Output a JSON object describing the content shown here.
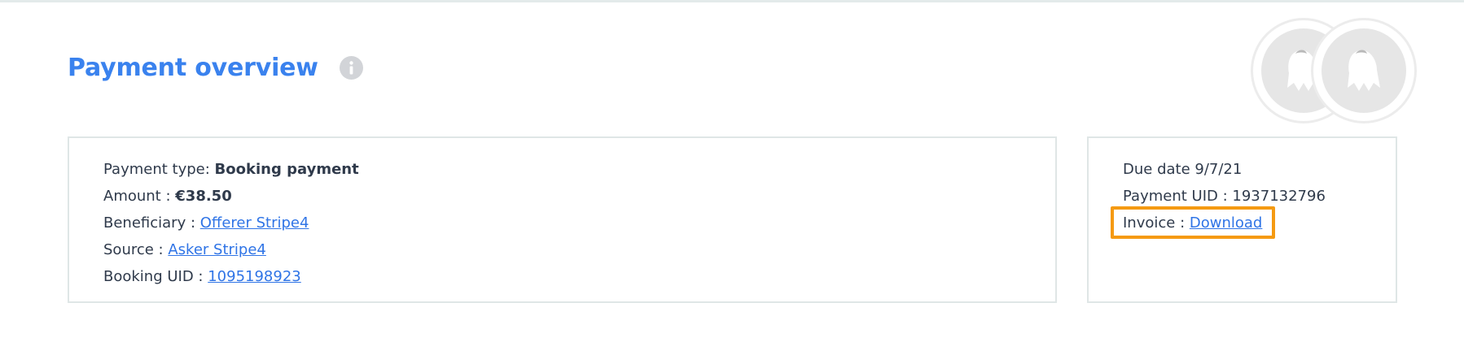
{
  "header": {
    "title": "Payment overview"
  },
  "payment": {
    "type_label": "Payment type:",
    "type_value": "Booking payment",
    "amount_label": "Amount :",
    "amount_value": "€38.50",
    "beneficiary_label": "Beneficiary :",
    "beneficiary_value": "Offerer Stripe4",
    "source_label": "Source :",
    "source_value": "Asker Stripe4",
    "booking_uid_label": "Booking UID :",
    "booking_uid_value": "1095198923"
  },
  "side": {
    "due_date_label": "Due date",
    "due_date_value": "9/7/21",
    "payment_uid_label": "Payment UID :",
    "payment_uid_value": "1937132796",
    "invoice_label": "Invoice :",
    "invoice_link": "Download"
  },
  "colors": {
    "title": "#3a82ee",
    "link": "#2f74e6",
    "highlight": "#f59a12",
    "border": "#dfe6e6"
  },
  "icons": {
    "info": "info-icon",
    "avatar": "ghost-avatar-icon"
  }
}
